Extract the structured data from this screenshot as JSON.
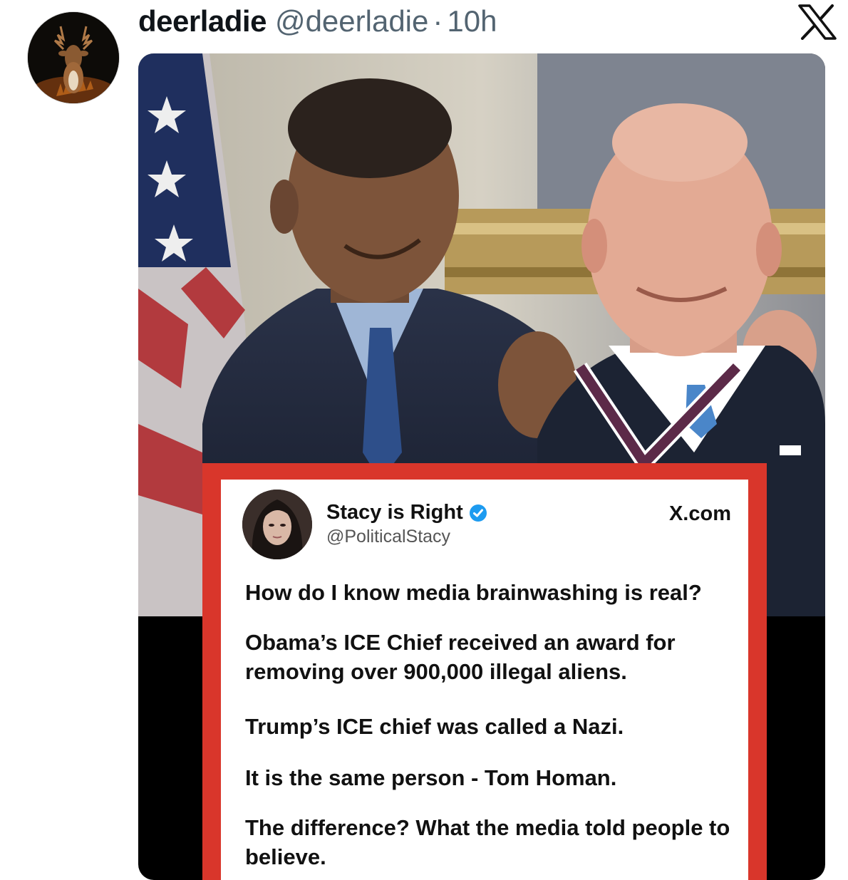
{
  "tweet": {
    "display_name": "deerladie",
    "handle": "@deerladie",
    "separator": "·",
    "time": "10h",
    "platform_icon": "x-logo-icon",
    "avatar_icon": "deer-icon"
  },
  "media": {
    "embedded_post": {
      "name": "Stacy is Right",
      "handle": "@PoliticalStacy",
      "site": "X.com",
      "verified_icon": "verified-badge-icon",
      "paragraphs": [
        "How do I know media brainwashing is real?",
        "Obama’s ICE Chief received an award for removing over 900,000 illegal aliens.",
        "Trump’s ICE chief was called a Nazi.",
        "It is the same person - Tom Homan.",
        "The difference? What the media told people to believe."
      ]
    }
  },
  "colors": {
    "card_border": "#d9362b",
    "verified": "#1d9bf0",
    "secondary_text": "#536471"
  }
}
